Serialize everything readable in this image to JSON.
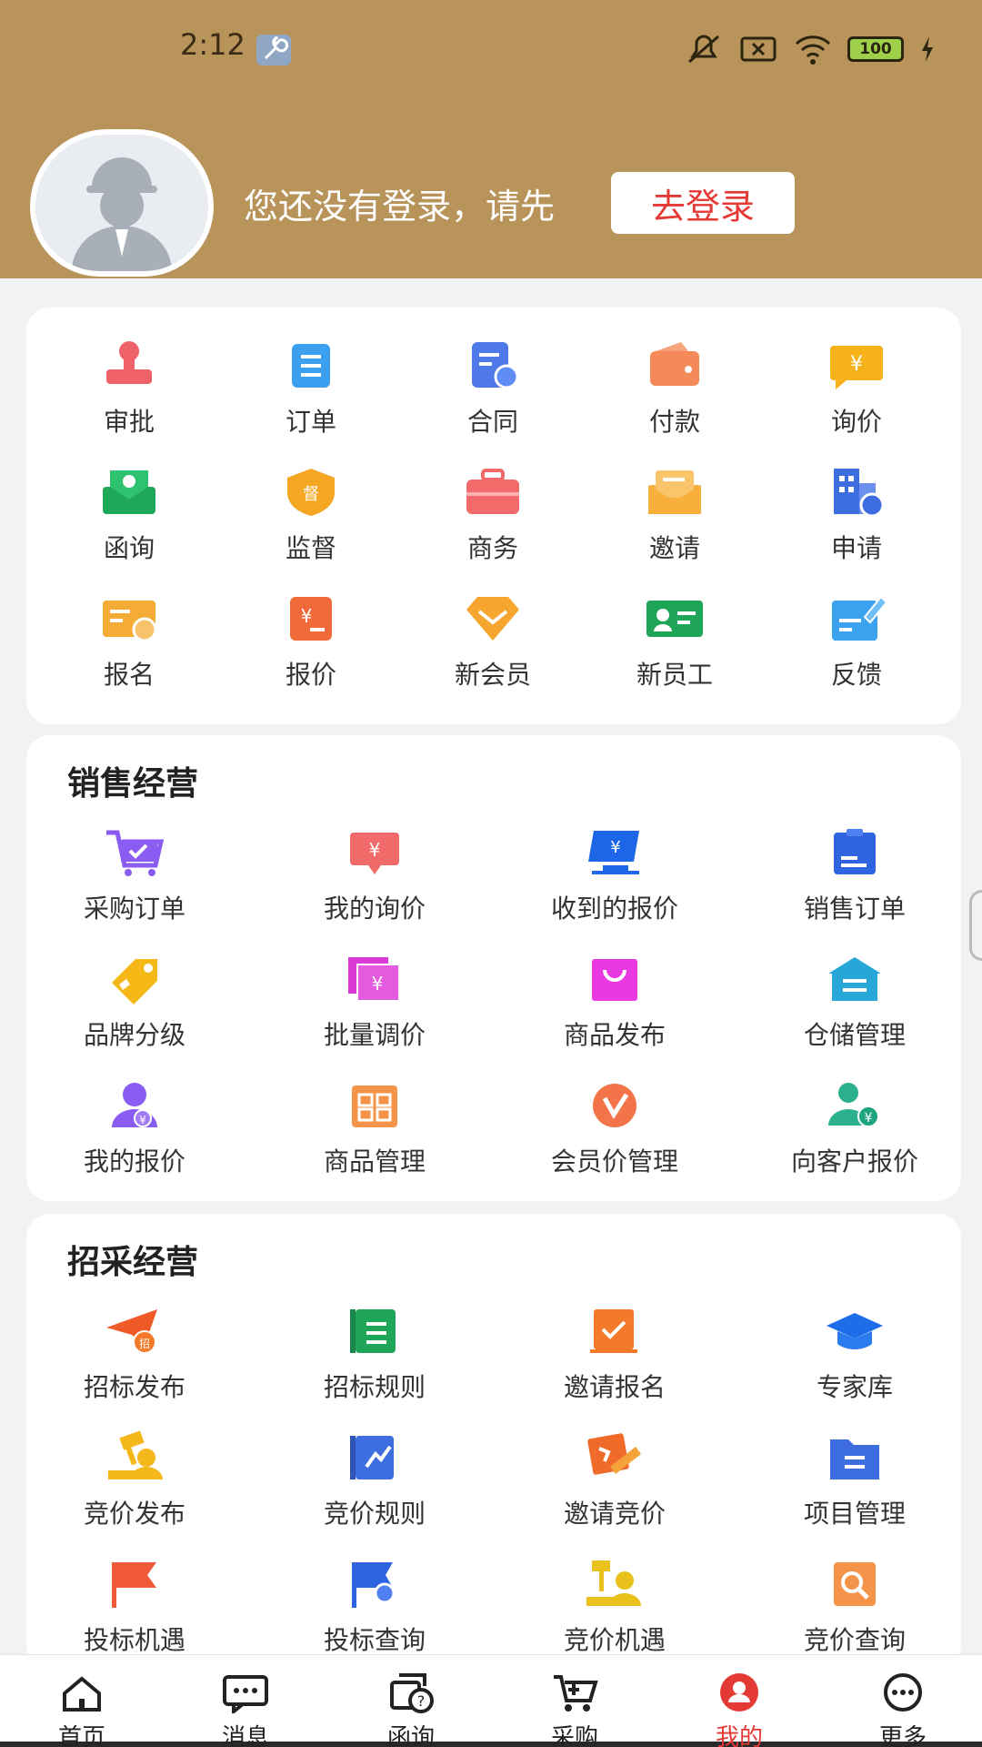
{
  "status_bar": {
    "time": "2:12",
    "battery": "100"
  },
  "profile": {
    "login_prompt": "您还没有登录，请先",
    "login_button": "去登录"
  },
  "quick_actions": [
    {
      "label": "审批",
      "icon": "approval-stamp-icon",
      "color": "#f0626a"
    },
    {
      "label": "订单",
      "icon": "order-clipboard-icon",
      "color": "#3aa0ef"
    },
    {
      "label": "合同",
      "icon": "contract-document-icon",
      "color": "#4f79e8"
    },
    {
      "label": "付款",
      "icon": "wallet-icon",
      "color": "#f4895a"
    },
    {
      "label": "询价",
      "icon": "inquiry-price-icon",
      "color": "#f6b21b"
    },
    {
      "label": "函询",
      "icon": "letter-inquiry-icon",
      "color": "#1fa857"
    },
    {
      "label": "监督",
      "icon": "supervision-shield-icon",
      "color": "#f5a623"
    },
    {
      "label": "商务",
      "icon": "briefcase-icon",
      "color": "#f46a6a"
    },
    {
      "label": "邀请",
      "icon": "invitation-envelope-icon",
      "color": "#f7b03c"
    },
    {
      "label": "申请",
      "icon": "application-building-icon",
      "color": "#3e6de0"
    },
    {
      "label": "报名",
      "icon": "registration-card-icon",
      "color": "#f4ac35"
    },
    {
      "label": "报价",
      "icon": "quote-document-icon",
      "color": "#f06a3a"
    },
    {
      "label": "新会员",
      "icon": "new-member-diamond-icon",
      "color": "#f6a52e"
    },
    {
      "label": "新员工",
      "icon": "new-employee-badge-icon",
      "color": "#1ea557"
    },
    {
      "label": "反馈",
      "icon": "feedback-edit-icon",
      "color": "#3aa2ef"
    }
  ],
  "sales": {
    "title": "销售经营",
    "items": [
      {
        "label": "采购订单",
        "icon": "purchase-cart-icon",
        "color": "#8a5cf2"
      },
      {
        "label": "我的询价",
        "icon": "my-inquiry-icon",
        "color": "#f06a6a"
      },
      {
        "label": "收到的报价",
        "icon": "received-quote-monitor-icon",
        "color": "#1e66e8"
      },
      {
        "label": "销售订单",
        "icon": "sales-order-icon",
        "color": "#2e64e0"
      },
      {
        "label": "品牌分级",
        "icon": "brand-tag-icon",
        "color": "#f5b816"
      },
      {
        "label": "批量调价",
        "icon": "batch-price-icon",
        "color": "#d93ad6"
      },
      {
        "label": "商品发布",
        "icon": "product-publish-bag-icon",
        "color": "#e83ae0"
      },
      {
        "label": "仓储管理",
        "icon": "warehouse-icon",
        "color": "#26a7d8"
      },
      {
        "label": "我的报价",
        "icon": "my-quote-user-icon",
        "color": "#8a5cf2"
      },
      {
        "label": "商品管理",
        "icon": "product-management-icon",
        "color": "#f4944a"
      },
      {
        "label": "会员价管理",
        "icon": "member-price-icon",
        "color": "#f4744a"
      },
      {
        "label": "向客户报价",
        "icon": "customer-quote-icon",
        "color": "#2bb08e"
      }
    ]
  },
  "tender": {
    "title": "招采经营",
    "items": [
      {
        "label": "招标发布",
        "icon": "tender-publish-plane-icon",
        "color": "#f05a28"
      },
      {
        "label": "招标规则",
        "icon": "tender-rules-icon",
        "color": "#1ea557"
      },
      {
        "label": "邀请报名",
        "icon": "invite-registration-icon",
        "color": "#f47a2a"
      },
      {
        "label": "专家库",
        "icon": "expert-cap-icon",
        "color": "#1e6de8"
      },
      {
        "label": "竞价发布",
        "icon": "bid-publish-icon",
        "color": "#f5b81b"
      },
      {
        "label": "竞价规则",
        "icon": "bid-rules-icon",
        "color": "#3e6de0"
      },
      {
        "label": "邀请竞价",
        "icon": "invite-bid-icon",
        "color": "#f06a2a"
      },
      {
        "label": "项目管理",
        "icon": "project-folder-icon",
        "color": "#3e6de0"
      },
      {
        "label": "投标机遇",
        "icon": "bid-opportunity-flag-icon",
        "color": "#f05a3a"
      },
      {
        "label": "投标查询",
        "icon": "bid-query-flag-icon",
        "color": "#2e64e0"
      },
      {
        "label": "竞价机遇",
        "icon": "auction-opportunity-icon",
        "color": "#e8c21b"
      },
      {
        "label": "竞价查询",
        "icon": "auction-query-icon",
        "color": "#f4944a"
      }
    ]
  },
  "bottom_nav": [
    {
      "label": "首页",
      "icon": "home-icon"
    },
    {
      "label": "消息",
      "icon": "message-icon"
    },
    {
      "label": "函询",
      "icon": "letter-query-icon"
    },
    {
      "label": "采购",
      "icon": "cart-icon"
    },
    {
      "label": "我的",
      "icon": "profile-icon",
      "active": true
    },
    {
      "label": "更多",
      "icon": "more-icon"
    }
  ]
}
